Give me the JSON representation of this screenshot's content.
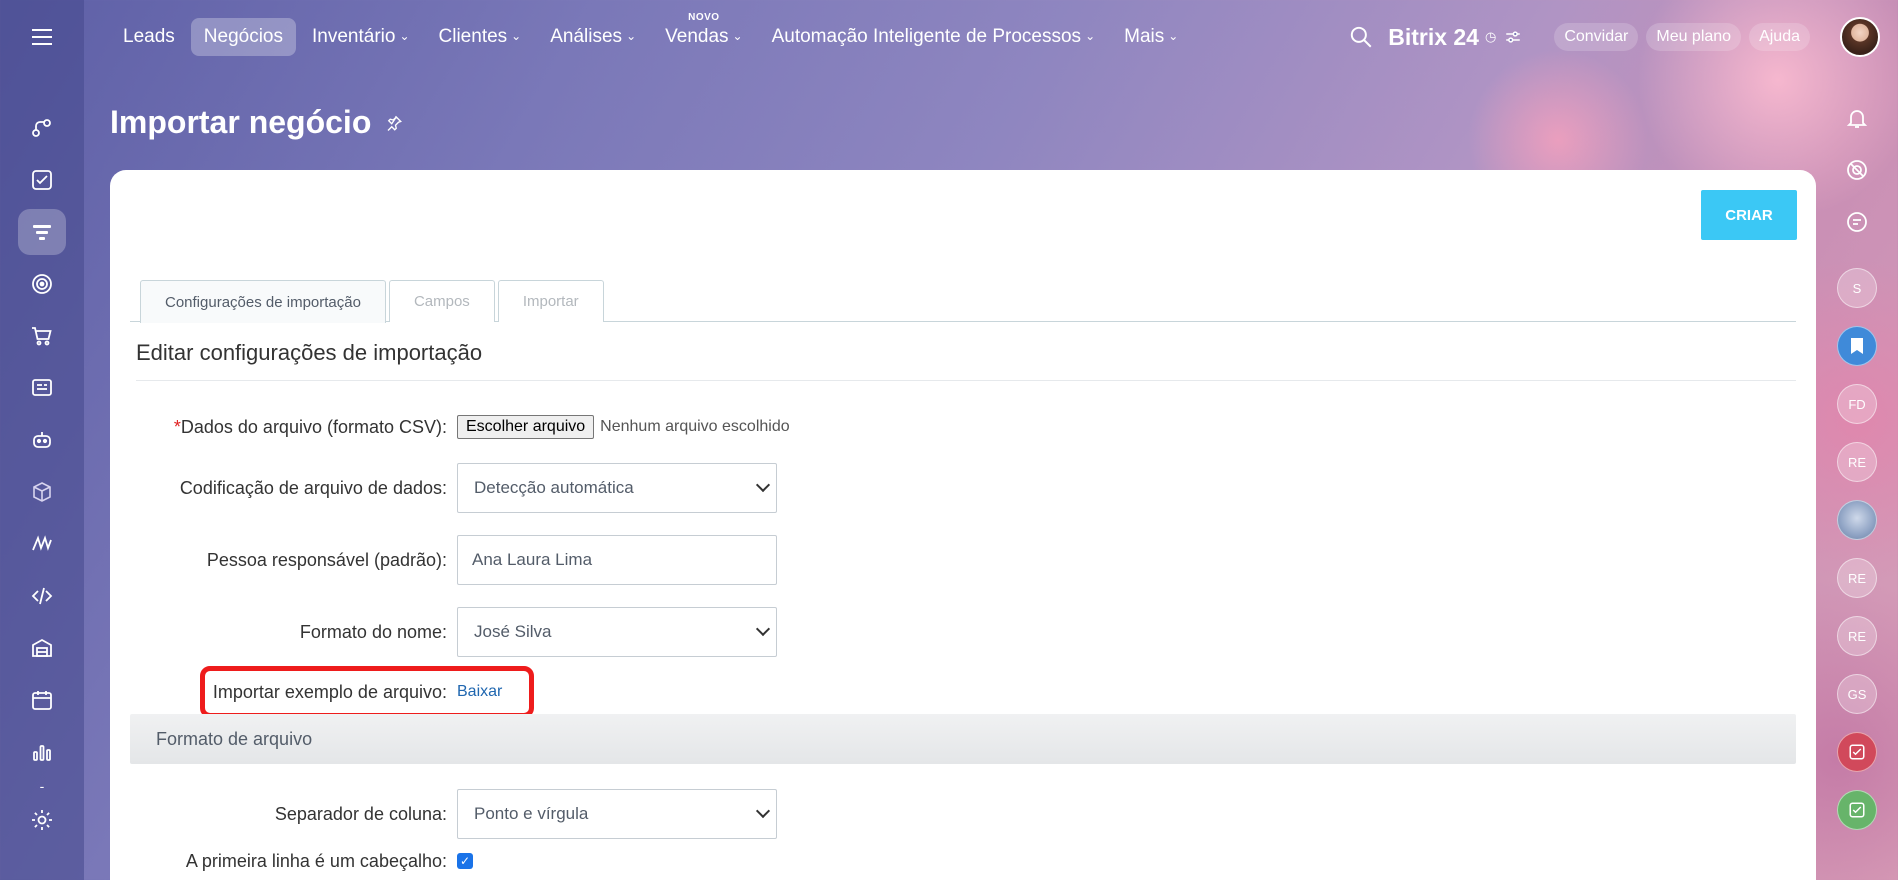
{
  "app": {
    "brand": "Bitrix",
    "brand_suffix": "24",
    "clock_glyph": "◷"
  },
  "nav": {
    "items": [
      {
        "label": "Leads",
        "has_chevron": false
      },
      {
        "label": "Negócios",
        "has_chevron": false,
        "active": true
      },
      {
        "label": "Inventário",
        "has_chevron": true
      },
      {
        "label": "Clientes",
        "has_chevron": true
      },
      {
        "label": "Análises",
        "has_chevron": true
      },
      {
        "label": "Vendas",
        "has_chevron": true,
        "badge": "NOVO"
      },
      {
        "label": "Automação Inteligente de Processos",
        "has_chevron": true
      },
      {
        "label": "Mais",
        "has_chevron": true
      }
    ],
    "chevron_glyph": "⌄"
  },
  "header_actions": {
    "invite": "Convidar",
    "plan": "Meu plano",
    "help": "Ajuda"
  },
  "page": {
    "title": "Importar negócio",
    "create_button": "CRIAR",
    "tabs": [
      {
        "label": "Configurações de importação",
        "active": true
      },
      {
        "label": "Campos",
        "active": false
      },
      {
        "label": "Importar",
        "active": false
      }
    ],
    "section_heading": "Editar configurações de importação"
  },
  "form": {
    "file_label_required": "*",
    "file_label": "Dados do arquivo (formato CSV):",
    "file_button": "Escolher arquivo",
    "file_status": "Nenhum arquivo escolhido",
    "encoding_label": "Codificação de arquivo de dados:",
    "encoding_value": "Detecção automática",
    "responsible_label": "Pessoa responsável (padrão):",
    "responsible_value": "Ana Laura Lima",
    "name_format_label": "Formato do nome:",
    "name_format_value": "José Silva",
    "example_label": "Importar exemplo de arquivo:",
    "example_link": "Baixar",
    "group_header": "Formato de arquivo",
    "separator_label": "Separador de coluna:",
    "separator_value": "Ponto e vírgula",
    "header_row_label": "A primeira linha é um cabeçalho:",
    "header_row_checked": true
  },
  "right_rail": {
    "avatars": [
      {
        "initials": "S",
        "style": "plain"
      },
      {
        "initials": "",
        "style": "blue",
        "icon": "bookmark-icon"
      },
      {
        "initials": "FD",
        "style": "plain"
      },
      {
        "initials": "RE",
        "style": "plain"
      },
      {
        "initials": "",
        "style": "cat",
        "icon": "cat-avatar"
      },
      {
        "initials": "RE",
        "style": "plain"
      },
      {
        "initials": "RE",
        "style": "plain"
      },
      {
        "initials": "GS",
        "style": "plain"
      },
      {
        "initials": "",
        "style": "red",
        "icon": "task-icon"
      },
      {
        "initials": "",
        "style": "green",
        "icon": "check-icon"
      }
    ]
  },
  "colors": {
    "accent": "#3bc8f5",
    "highlight": "#ee1c1c",
    "link": "#2067b0"
  }
}
